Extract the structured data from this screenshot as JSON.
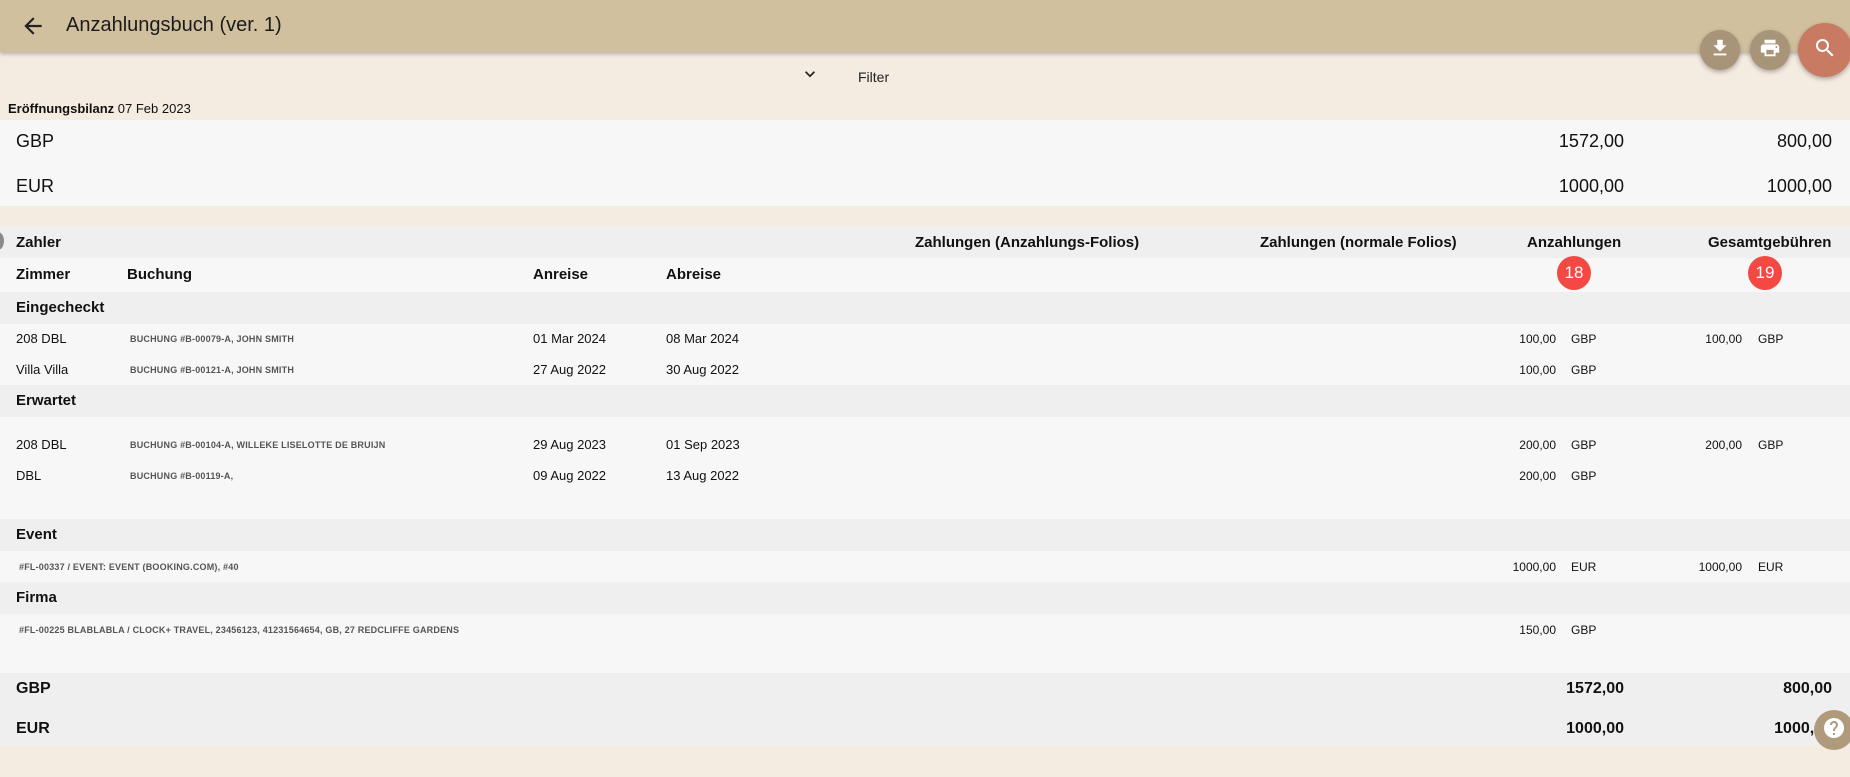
{
  "header": {
    "title": "Anzahlungsbuch (ver. 1)",
    "back_icon": "arrow-back-icon"
  },
  "actions": {
    "download_icon": "download-icon",
    "print_icon": "print-icon",
    "search_icon": "search-icon"
  },
  "filter": {
    "label": "Filter",
    "icon": "chevron-down-icon"
  },
  "opening": {
    "label": "Eröffnungsbilanz",
    "date": "07 Feb 2023"
  },
  "opening_balances": [
    {
      "currency": "GBP",
      "deposits": "1572,00",
      "total_fees": "800,00"
    },
    {
      "currency": "EUR",
      "deposits": "1000,00",
      "total_fees": "1000,00"
    }
  ],
  "columns": {
    "payer": "Zahler",
    "payments_deposit": "Zahlungen (Anzahlungs-Folios)",
    "payments_normal": "Zahlungen (normale Folios)",
    "deposits": "Anzahlungen",
    "total_fees": "Gesamtgebühren",
    "room": "Zimmer",
    "booking": "Buchung",
    "arrival": "Anreise",
    "departure": "Abreise"
  },
  "badges": {
    "deposits": "18",
    "total_fees": "19"
  },
  "groups": {
    "checked_in": {
      "title": "Eingecheckt",
      "rows": [
        {
          "room": "208 DBL",
          "booking": "BUCHUNG #B-00079-A, JOHN SMITH",
          "arrival": "01 Mar 2024",
          "departure": "08 Mar 2024",
          "deposit": "100,00",
          "deposit_cur": "GBP",
          "fee": "100,00",
          "fee_cur": "GBP"
        },
        {
          "room": "Villa Villa",
          "booking": "BUCHUNG #B-00121-A, JOHN SMITH",
          "arrival": "27 Aug 2022",
          "departure": "30 Aug 2022",
          "deposit": "100,00",
          "deposit_cur": "GBP"
        }
      ]
    },
    "expected": {
      "title": "Erwartet",
      "rows": [
        {
          "room": "208 DBL",
          "booking": "BUCHUNG #B-00104-A, WILLEKE LISELOTTE DE BRUIJN",
          "arrival": "29 Aug 2023",
          "departure": "01 Sep 2023",
          "deposit": "200,00",
          "deposit_cur": "GBP",
          "fee": "200,00",
          "fee_cur": "GBP"
        },
        {
          "room": "DBL",
          "booking": "BUCHUNG #B-00119-A,",
          "arrival": "09 Aug 2022",
          "departure": "13 Aug 2022",
          "deposit": "200,00",
          "deposit_cur": "GBP"
        }
      ]
    },
    "event": {
      "title": "Event",
      "rows": [
        {
          "folio": "#FL-00337 / EVENT: EVENT (BOOKING.COM), #40",
          "deposit": "1000,00",
          "deposit_cur": "EUR",
          "fee": "1000,00",
          "fee_cur": "EUR"
        }
      ]
    },
    "company": {
      "title": "Firma",
      "rows": [
        {
          "folio": "#FL-00225 BLABLABLA / CLOCK+ TRAVEL, 23456123, 41231564654, GB, 27 REDCLIFFE GARDENS",
          "deposit": "150,00",
          "deposit_cur": "GBP"
        }
      ]
    }
  },
  "totals": [
    {
      "currency": "GBP",
      "deposits": "1572,00",
      "total_fees": "800,00"
    },
    {
      "currency": "EUR",
      "deposits": "1000,00",
      "total_fees": "1000,00"
    }
  ],
  "help_icon": "help-icon",
  "colors": {
    "topbar": "#d0c09e",
    "background": "#f4ebe1",
    "badge": "#f44842",
    "search_fab": "#c97a62"
  }
}
